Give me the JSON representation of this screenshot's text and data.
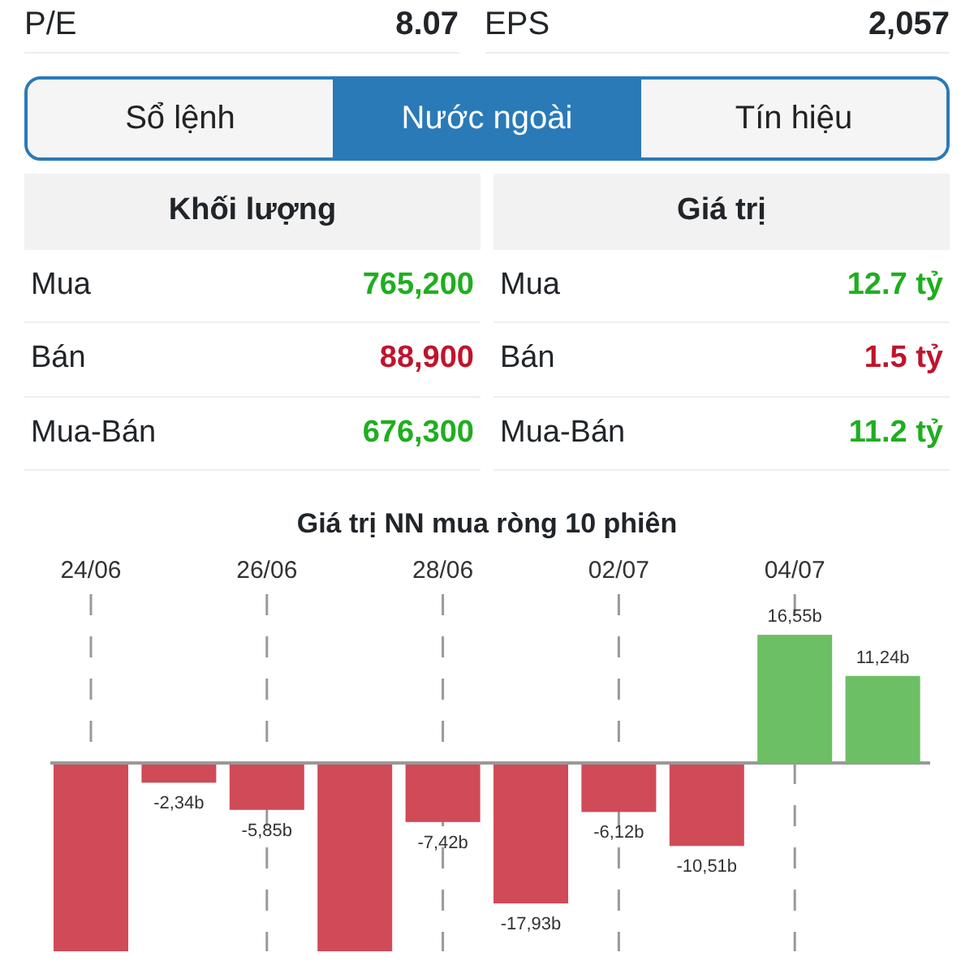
{
  "stats": [
    {
      "label": "P/E",
      "value": "8.07"
    },
    {
      "label": "EPS",
      "value": "2,057"
    }
  ],
  "tabs": [
    {
      "label": "Sổ lệnh",
      "selected": false
    },
    {
      "label": "Nước ngoài",
      "selected": true
    },
    {
      "label": "Tín hiệu",
      "selected": false
    }
  ],
  "tables": [
    {
      "title": "Khối lượng",
      "rows": [
        {
          "label": "Mua",
          "value": "765,200",
          "color": "#1fae1f"
        },
        {
          "label": "Bán",
          "value": "88,900",
          "color": "#c0142c"
        },
        {
          "label": "Mua-Bán",
          "value": "676,300",
          "color": "#1fae1f"
        }
      ]
    },
    {
      "title": "Giá trị",
      "rows": [
        {
          "label": "Mua",
          "value": "12.7 tỷ",
          "color": "#1fae1f"
        },
        {
          "label": "Bán",
          "value": "1.5 tỷ",
          "color": "#c0142c"
        },
        {
          "label": "Mua-Bán",
          "value": "11.2 tỷ",
          "color": "#1fae1f"
        }
      ]
    }
  ],
  "chart": {
    "chart_data": {
      "type": "bar",
      "title": "Giá trị NN mua ròng 10 phiên",
      "categories": [
        "24/06",
        null,
        "26/06",
        null,
        "28/06",
        null,
        "02/07",
        null,
        "04/07",
        null
      ],
      "grid": true,
      "data_labels": true,
      "series": [
        {
          "color": "#d04a57",
          "values": [
            null,
            -2.34,
            -5.85,
            null,
            -7.42,
            -17.93,
            -6.12,
            -10.51,
            null,
            null
          ],
          "value_labels": [
            null,
            "-2,34b",
            "-5,85b",
            null,
            "-7,42b",
            "-17,93b",
            "-6,12b",
            "-10,51b",
            null,
            null
          ]
        },
        {
          "color": "#6cbf63",
          "values": [
            null,
            null,
            null,
            null,
            null,
            null,
            null,
            null,
            16.55,
            11.24
          ],
          "value_labels": [
            null,
            null,
            null,
            null,
            null,
            null,
            null,
            null,
            "16,55b",
            "11,24b"
          ]
        }
      ]
    }
  }
}
